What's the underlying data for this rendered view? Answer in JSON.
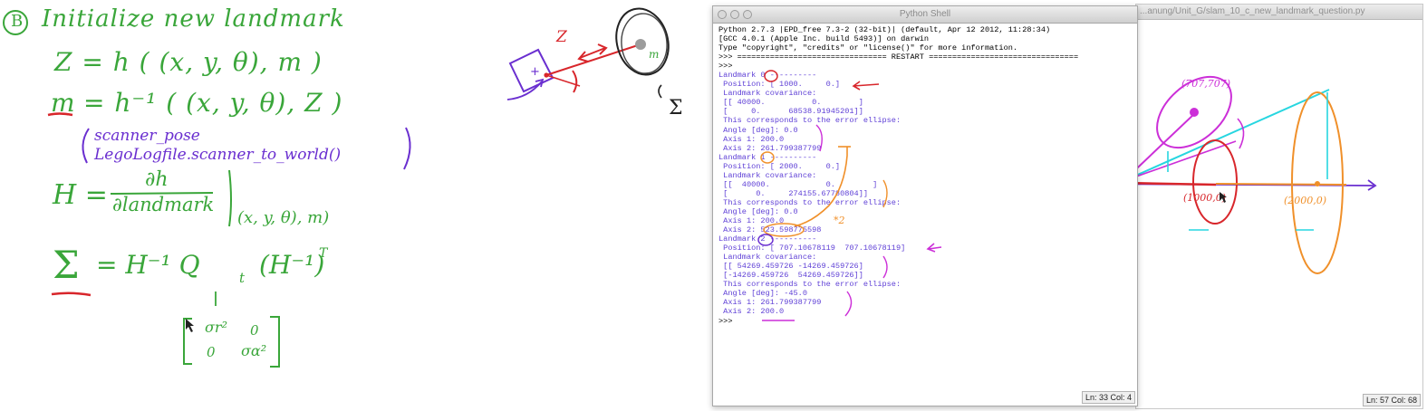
{
  "whiteboard": {
    "step_marker": "B",
    "heading": "Initialize new landmark",
    "eq_forward": "Z = h ( (x, y, θ), m )",
    "eq_m": "m",
    "eq_inverse_rest": "= h⁻¹ ( (x, y, θ), Z )",
    "note_line1": "scanner_pose",
    "note_line2": "LegoLogfile.scanner_to_world()",
    "eq_H_lhs": "H =",
    "eq_H_num": "∂h",
    "eq_H_den": "∂landmark",
    "eq_H_sub": "(x, y, θ), m)",
    "eq_sigma_sym": "Σ",
    "eq_sigma_rhs": "=   H⁻¹   Q",
    "eq_sigma_qsub": "t",
    "eq_sigma_tail": "(H⁻¹)",
    "eq_sigma_tsup": "T",
    "matrix_r1c1": "σr²",
    "matrix_r1c2": "0",
    "matrix_r2c1": "0",
    "matrix_r2c2": "σα²"
  },
  "sketch": {
    "label_z": "Z",
    "label_m": "m",
    "label_sigma": "Σ"
  },
  "back_window": {
    "path": "...anung/Unit_G/slam_10_c_new_landmark_question.py",
    "status": "Ln: 57 Col: 68",
    "label_pt1": "(707,707)",
    "label_pt2": "(1000,0)",
    "label_pt3": "(2000,0)"
  },
  "shell": {
    "title": "Python Shell",
    "status": "Ln: 33 Col: 4",
    "lines": [
      {
        "text": "Python 2.7.3 |EPD_free 7.3-2 (32-bit)| (default, Apr 12 2012, 11:28:34)",
        "kind": "sys"
      },
      {
        "text": "[GCC 4.0.1 (Apple Inc. build 5493)] on darwin",
        "kind": "sys"
      },
      {
        "text": "Type \"copyright\", \"credits\" or \"license()\" for more information.",
        "kind": "sys"
      },
      {
        "text": ">>> ================================ RESTART ================================",
        "kind": "sys"
      },
      {
        "text": ">>> ",
        "kind": "sys"
      },
      {
        "text": "Landmark 0 ----------",
        "kind": "out"
      },
      {
        "text": " Position: [ 1000.     0.]",
        "kind": "out"
      },
      {
        "text": " Landmark covariance:",
        "kind": "out"
      },
      {
        "text": " [[ 40000.          0.        ]",
        "kind": "out"
      },
      {
        "text": " [     0.      68538.91945201]]",
        "kind": "out"
      },
      {
        "text": " This corresponds to the error ellipse:",
        "kind": "out"
      },
      {
        "text": " Angle [deg]: 0.0",
        "kind": "out"
      },
      {
        "text": " Axis 1: 200.0",
        "kind": "out"
      },
      {
        "text": " Axis 2: 261.799387799",
        "kind": "out"
      },
      {
        "text": "Landmark 1 ----------",
        "kind": "out"
      },
      {
        "text": " Position: [ 2000.     0.]",
        "kind": "out"
      },
      {
        "text": " Landmark covariance:",
        "kind": "out"
      },
      {
        "text": " [[  40000.            0.        ]",
        "kind": "out"
      },
      {
        "text": " [      0.     274155.67780804]]",
        "kind": "out"
      },
      {
        "text": " This corresponds to the error ellipse:",
        "kind": "out"
      },
      {
        "text": " Angle [deg]: 0.0",
        "kind": "out"
      },
      {
        "text": " Axis 1: 200.0",
        "kind": "out"
      },
      {
        "text": " Axis 2: 523.598775598",
        "kind": "out"
      },
      {
        "text": "Landmark 2 ----------",
        "kind": "out"
      },
      {
        "text": " Position: [ 707.10678119  707.10678119]",
        "kind": "out"
      },
      {
        "text": " Landmark covariance:",
        "kind": "out"
      },
      {
        "text": " [[ 54269.459726 -14269.459726]",
        "kind": "out"
      },
      {
        "text": " [-14269.459726  54269.459726]]",
        "kind": "out"
      },
      {
        "text": " This corresponds to the error ellipse:",
        "kind": "out"
      },
      {
        "text": " Angle [deg]: -45.0",
        "kind": "out"
      },
      {
        "text": " Axis 1: 261.799387799",
        "kind": "out"
      },
      {
        "text": " Axis 2: 200.0",
        "kind": "out"
      },
      {
        "text": ">>> ",
        "kind": "sys"
      }
    ]
  },
  "colors": {
    "marker_green": "#3aa63a",
    "marker_purple": "#6a2fd0",
    "marker_red": "#d8262b",
    "marker_orange": "#f0902a",
    "marker_magenta": "#cc2fd8",
    "marker_cyan": "#27d6e0",
    "shell_output": "#5e3fd6"
  }
}
